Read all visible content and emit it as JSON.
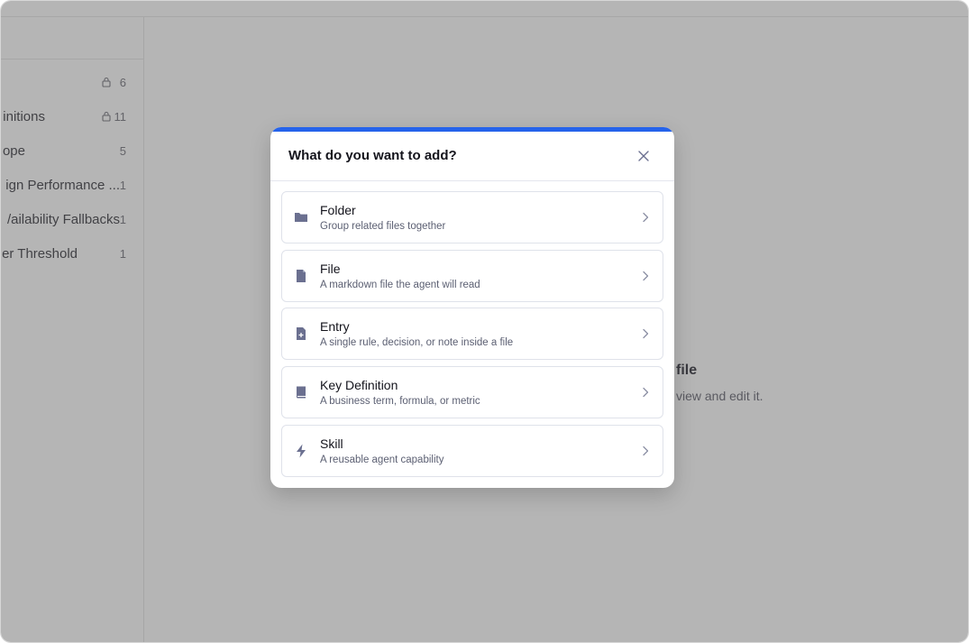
{
  "sidebar": {
    "items": [
      {
        "label": "",
        "count": "6",
        "locked": true
      },
      {
        "label": "initions",
        "count": "11",
        "locked": true
      },
      {
        "label": "ope",
        "count": "5",
        "locked": false
      },
      {
        "label": "ign Performance ...",
        "count": "1",
        "locked": false
      },
      {
        "label": "/ailability Fallbacks",
        "count": "1",
        "locked": false
      },
      {
        "label": "er Threshold",
        "count": "1",
        "locked": false
      }
    ]
  },
  "main": {
    "empty_title": "file",
    "empty_subtitle": "view and edit it."
  },
  "modal": {
    "title": "What do you want to add?",
    "accent_color": "#2563eb",
    "close_icon": "close-icon",
    "options": [
      {
        "title": "Folder",
        "description": "Group related files together",
        "icon": "folder-icon"
      },
      {
        "title": "File",
        "description": "A markdown file the agent will read",
        "icon": "file-icon"
      },
      {
        "title": "Entry",
        "description": "A single rule, decision, or note inside a file",
        "icon": "entry-icon"
      },
      {
        "title": "Key Definition",
        "description": "A business term, formula, or metric",
        "icon": "book-icon"
      },
      {
        "title": "Skill",
        "description": "A reusable agent capability",
        "icon": "lightning-icon"
      }
    ]
  },
  "colors": {
    "icon": "#6b7090",
    "overlay": "rgba(90,90,90,0.45)"
  }
}
